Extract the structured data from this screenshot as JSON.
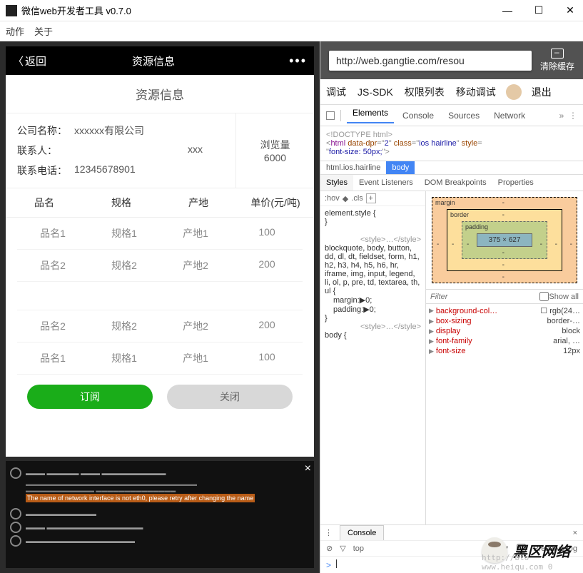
{
  "window": {
    "title": "微信web开发者工具 v0.7.0",
    "menu": [
      "动作",
      "关于"
    ],
    "controls": {
      "min": "—",
      "max": "☐",
      "close": "✕"
    }
  },
  "simulator": {
    "nav": {
      "back": "返回",
      "title": "资源信息",
      "more": "•••"
    },
    "page_title": "资源信息",
    "info": {
      "rows": [
        {
          "label": "公司名称：",
          "value": "xxxxxx有限公司"
        },
        {
          "label": "联系人：",
          "value": "xxx"
        },
        {
          "label": "联系电话：",
          "value": "12345678901"
        }
      ],
      "views_label": "浏览量",
      "views_value": "6000"
    },
    "table": {
      "headers": [
        "品名",
        "规格",
        "产地",
        "单价(元/吨)"
      ],
      "rows": [
        [
          "品名1",
          "规格1",
          "产地1",
          "100"
        ],
        [
          "品名2",
          "规格2",
          "产地2",
          "200"
        ],
        [
          "",
          "",
          "",
          ""
        ],
        [
          "品名2",
          "规格2",
          "产地2",
          "200"
        ],
        [
          "品名1",
          "规格1",
          "产地1",
          "100"
        ]
      ]
    },
    "buttons": {
      "subscribe": "订阅",
      "close": "关闭"
    },
    "console_highlight": "The name of network interface is not eth0, please retry after changing the name"
  },
  "devtools": {
    "address": "http://web.gangtie.com/resou",
    "clear_cache": "清除缓存",
    "tabs": [
      "调试",
      "JS-SDK",
      "权限列表",
      "移动调试"
    ],
    "exit": "退出",
    "tool_tabs": [
      "Elements",
      "Console",
      "Sources",
      "Network"
    ],
    "doctype": "<!DOCTYPE html>",
    "html_line": "<html data-dpr=\"2\" class=\"ios hairline\" style=\"font-size: 50px;\">",
    "breadcrumb": [
      "html.ios.hairline",
      "body"
    ],
    "style_tabs": [
      "Styles",
      "Event Listeners",
      "DOM Breakpoints",
      "Properties"
    ],
    "hov": ":hov",
    "cls": ".cls",
    "element_style": "element.style {",
    "css_selector": "blockquote, body, button, dd, dl, dt, fieldset, form, h1, h2, h3, h4, h5, h6, hr, iframe, img, input, legend, li, ol, p, pre, td, textarea, th, ul {",
    "css_rules": [
      "margin:▶0;",
      "padding:▶0;"
    ],
    "body_rule": "body {",
    "style_tag": "<style>…</style>",
    "box": {
      "margin": "margin",
      "border": "border",
      "padding": "padding",
      "content": "375 × 627",
      "dash": "-"
    },
    "filter_placeholder": "Filter",
    "show_all": "Show all",
    "props": [
      {
        "name": "background-col…",
        "val": "☐ rgb(24…"
      },
      {
        "name": "box-sizing",
        "val": "border-…"
      },
      {
        "name": "display",
        "val": "block"
      },
      {
        "name": "font-family",
        "val": "arial, …"
      },
      {
        "name": "font-size",
        "val": "12px"
      }
    ],
    "console_tab": "Console",
    "top": "top",
    "preserve_log": "Preserve log",
    "prompt": ">"
  },
  "watermark": {
    "text": "黑区网络",
    "sub": "http://blo  www.heiqu.com 0"
  }
}
